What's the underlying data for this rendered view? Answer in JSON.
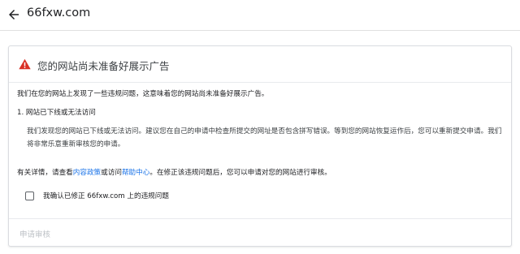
{
  "header": {
    "site": "66fxw.com",
    "back_icon": "arrow-left-icon"
  },
  "card": {
    "warning_icon": "warning-triangle-icon",
    "warning_color": "#d93025",
    "title": "您的网站尚未准备好展示广告",
    "intro": "我们在您的网站上发现了一些违规问题，这意味着您的网站尚未准备好展示广告。",
    "issue": {
      "title": "1. 网站已下线或无法访问",
      "body": "我们发现您的网站已下线或无法访问。建议您在自己的申请中检查所提交的网址是否包含拼写错误。等到您的网站恢复运作后，您可以重新提交申请。我们将非常乐意重新审核您的申请。"
    },
    "details": {
      "prefix": "有关详情，请查看",
      "policy_link": "内容政策",
      "middle": "或访问",
      "help_link": "帮助中心",
      "suffix": "。在修正该违规问题后，您可以申请对您的网站进行审核。"
    },
    "confirm_label": "我确认已修正 66fxw.com 上的违规问题",
    "confirm_checked": false,
    "request_review": "申请审核"
  },
  "colors": {
    "link": "#1a73e8",
    "disabled_text": "#bdc1c6"
  }
}
